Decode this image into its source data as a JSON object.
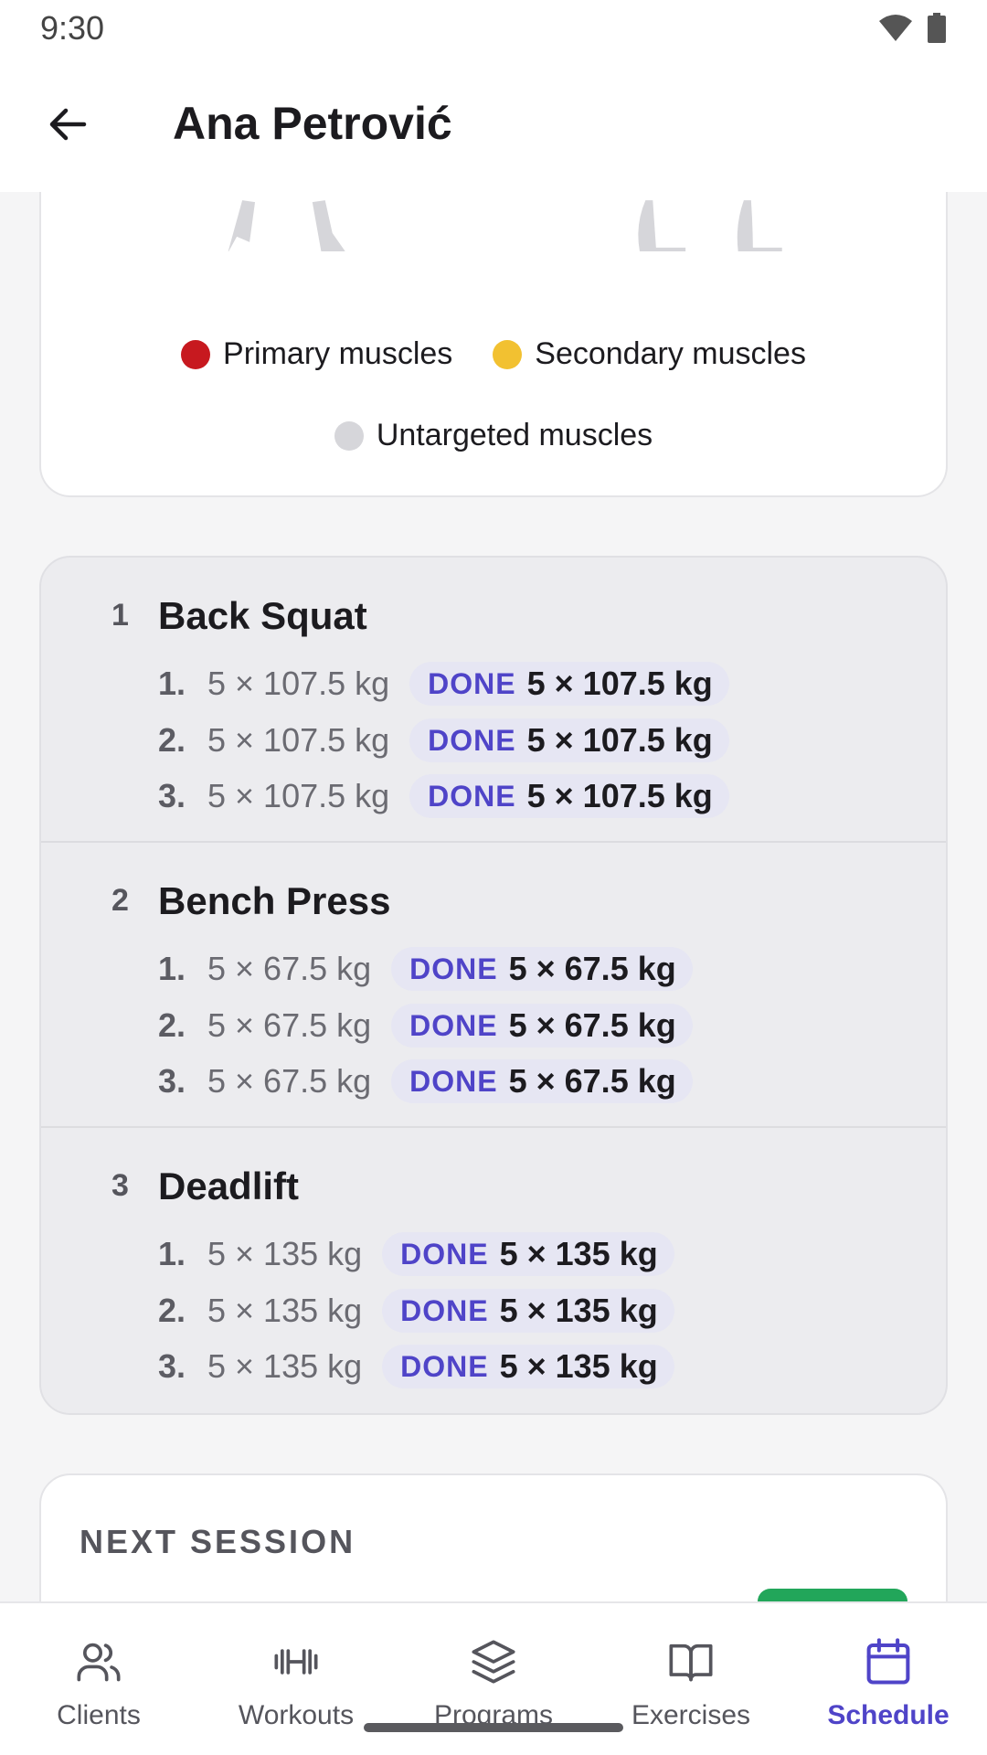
{
  "status_bar": {
    "time": "9:30"
  },
  "app_bar": {
    "title": "Ana Petrović"
  },
  "legend": {
    "primary": "Primary muscles",
    "secondary": "Secondary muscles",
    "untargeted": "Untargeted muscles",
    "colors": {
      "primary": "#c7191f",
      "secondary": "#f2c131",
      "untargeted": "#d6d6da"
    }
  },
  "exercises": [
    {
      "number": "1",
      "name": "Back Squat",
      "sets": [
        {
          "idx": "1.",
          "planned": "5 × 107.5 kg",
          "status": "DONE",
          "actual": "5 × 107.5 kg"
        },
        {
          "idx": "2.",
          "planned": "5 × 107.5 kg",
          "status": "DONE",
          "actual": "5 × 107.5 kg"
        },
        {
          "idx": "3.",
          "planned": "5 × 107.5 kg",
          "status": "DONE",
          "actual": "5 × 107.5 kg"
        }
      ]
    },
    {
      "number": "2",
      "name": "Bench Press",
      "sets": [
        {
          "idx": "1.",
          "planned": "5 × 67.5 kg",
          "status": "DONE",
          "actual": "5 × 67.5 kg"
        },
        {
          "idx": "2.",
          "planned": "5 × 67.5 kg",
          "status": "DONE",
          "actual": "5 × 67.5 kg"
        },
        {
          "idx": "3.",
          "planned": "5 × 67.5 kg",
          "status": "DONE",
          "actual": "5 × 67.5 kg"
        }
      ]
    },
    {
      "number": "3",
      "name": "Deadlift",
      "sets": [
        {
          "idx": "1.",
          "planned": "5 × 135 kg",
          "status": "DONE",
          "actual": "5 × 135 kg"
        },
        {
          "idx": "2.",
          "planned": "5 × 135 kg",
          "status": "DONE",
          "actual": "5 × 135 kg"
        },
        {
          "idx": "3.",
          "planned": "5 × 135 kg",
          "status": "DONE",
          "actual": "5 × 135 kg"
        }
      ]
    }
  ],
  "next_session": {
    "title": "NEXT SESSION"
  },
  "bottom_nav": {
    "items": [
      {
        "label": "Clients",
        "icon": "users-icon"
      },
      {
        "label": "Workouts",
        "icon": "dumbbell-icon"
      },
      {
        "label": "Programs",
        "icon": "layers-icon"
      },
      {
        "label": "Exercises",
        "icon": "book-open-icon"
      },
      {
        "label": "Schedule",
        "icon": "calendar-icon",
        "active": true
      }
    ],
    "accent": "#4f44c8"
  }
}
